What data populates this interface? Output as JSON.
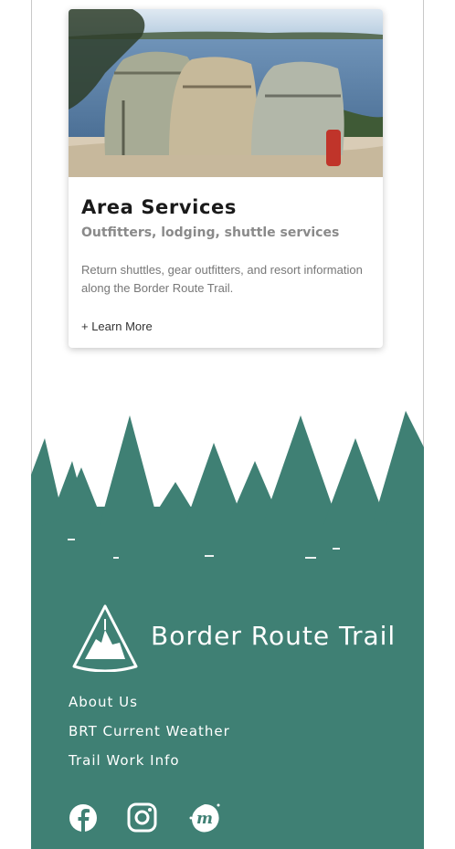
{
  "card": {
    "title": "Area Services",
    "subtitle": "Outfitters, lodging, shuttle services",
    "description": "Return shuttles, gear outfitters, and resort information along the Border Route Trail.",
    "link": "+ Learn More"
  },
  "footer": {
    "brand": "Border Route Trail",
    "links": [
      "About Us",
      "BRT Current Weather",
      "Trail Work Info"
    ],
    "social": [
      "facebook-icon",
      "instagram-icon",
      "meetup-icon"
    ],
    "bg_color": "#3f8074"
  }
}
